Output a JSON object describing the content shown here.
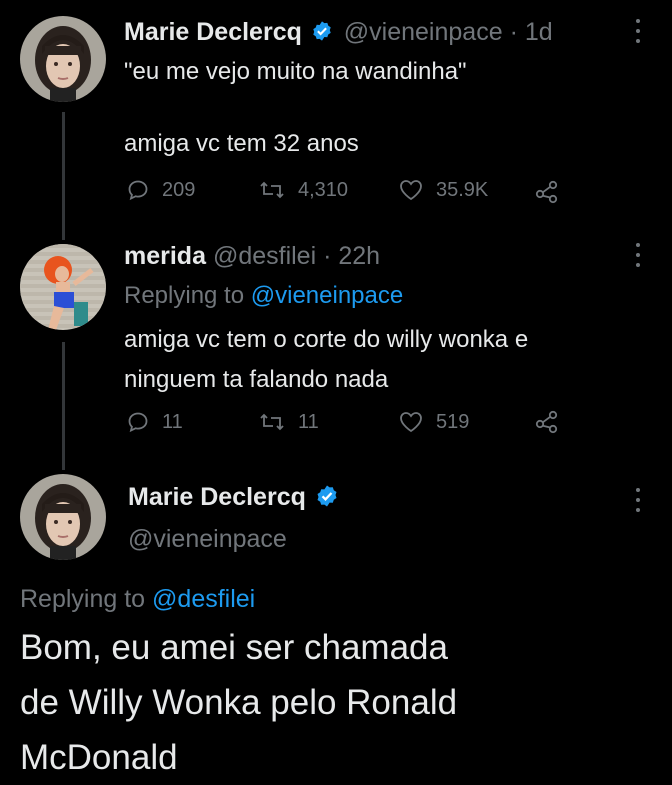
{
  "tweets": [
    {
      "name": "Marie Declercq",
      "handle": "@vieneinpace",
      "time": "1d",
      "verified": true,
      "text_line1": "\"eu me vejo muito na wandinha\"",
      "text_line2": "amiga vc tem 32 anos",
      "replies": "209",
      "retweets": "4,310",
      "likes": "35.9K"
    },
    {
      "name": "merida",
      "handle": "@desfilei",
      "time": "22h",
      "replying_prefix": "Replying to",
      "replying_to": "@vieneinpace",
      "text_line1": "amiga vc tem o corte do willy wonka e",
      "text_line2": "ninguem ta falando nada",
      "replies": "11",
      "retweets": "11",
      "likes": "519"
    }
  ],
  "main_tweet": {
    "name": "Marie Declercq",
    "handle": "@vieneinpace",
    "verified": true,
    "replying_prefix": "Replying to",
    "replying_to": "@desfilei",
    "text_line1": "Bom, eu amei ser chamada",
    "text_line2": "de Willy Wonka pelo Ronald",
    "text_line3": "McDonald"
  },
  "colors": {
    "background": "#000000",
    "text": "#e7e9ea",
    "muted": "#71767b",
    "link": "#1d9bf0",
    "verified": "#1d9bf0",
    "thread_line": "#333639"
  }
}
